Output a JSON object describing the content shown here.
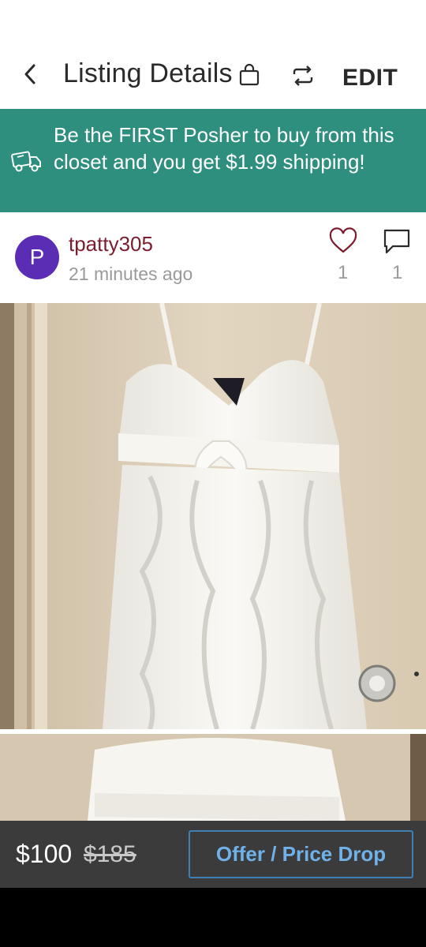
{
  "header": {
    "title": "Listing Details",
    "edit_label": "EDIT"
  },
  "banner": {
    "text": "Be the FIRST Posher to buy from this closet and you get $1.99 shipping!"
  },
  "seller": {
    "avatar_initial": "P",
    "username": "tpatty305",
    "time_ago": "21 minutes ago",
    "likes": "1",
    "comments": "1"
  },
  "pricing": {
    "price": "$100",
    "original_price": "$185",
    "offer_label": "Offer / Price Drop"
  },
  "colors": {
    "banner": "#2e8f7f",
    "username": "#7b1d2e",
    "avatar": "#5b2db5",
    "like_heart": "#7b1d2e",
    "offer_button": "#6fb1e8"
  }
}
